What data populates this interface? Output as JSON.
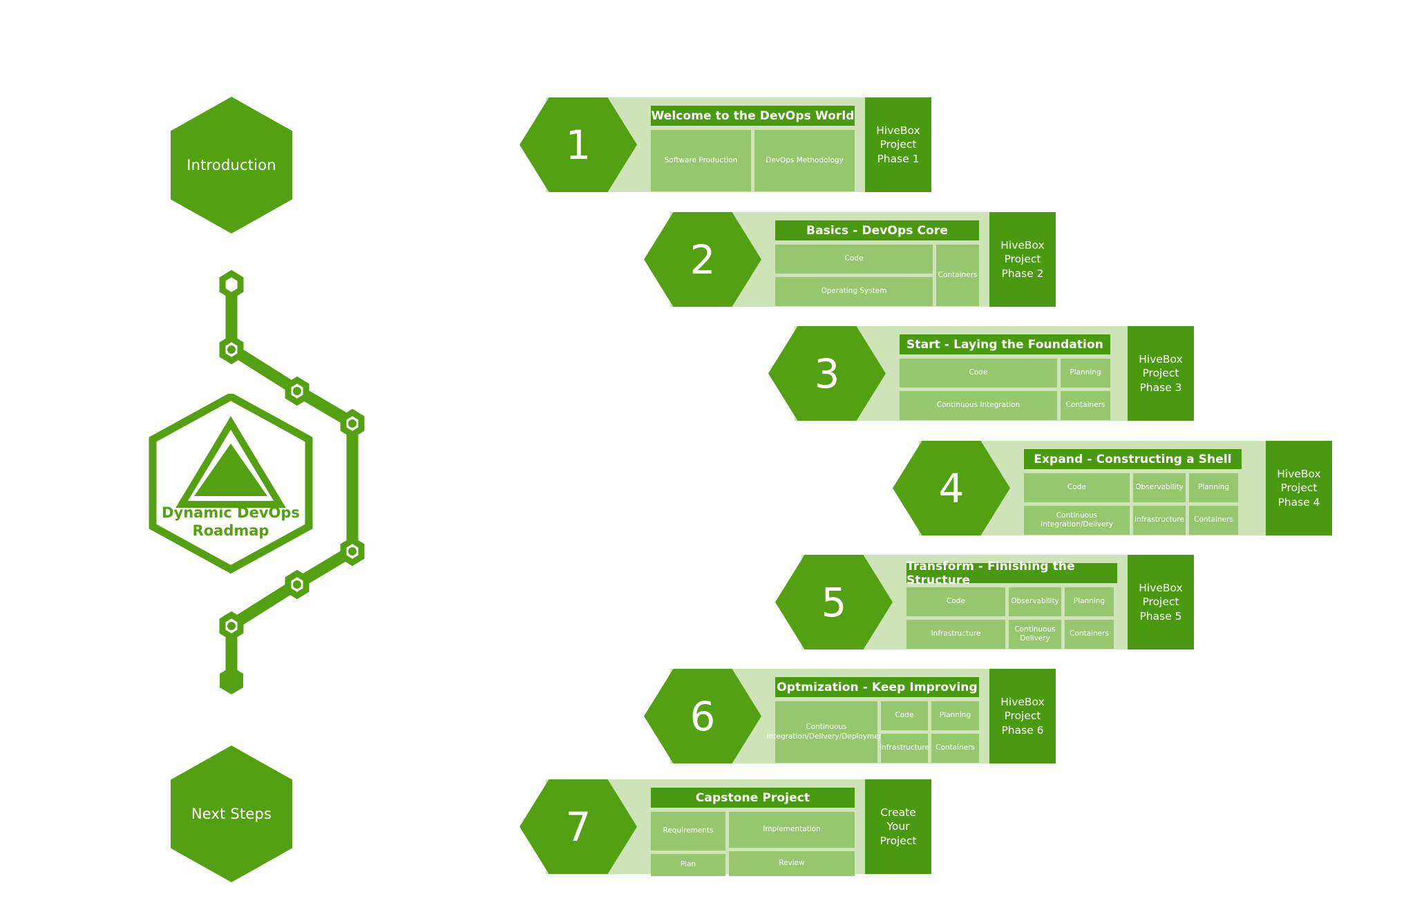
{
  "colors": {
    "dark_green": "#4a9a11",
    "hex_green": "#54a013",
    "band_light": "#cee3b8",
    "cell_green": "#96c76e",
    "white": "#ffffff"
  },
  "left_column": {
    "intro_label": "Introduction",
    "logo_title_line1": "Dynamic DevOps",
    "logo_title_line2": "Roadmap",
    "logo_icon": "triangle-in-hexagon-icon",
    "next_steps_label": "Next Steps",
    "chain_icon": "hexagon-chain-connector"
  },
  "rows": [
    {
      "number": "1",
      "title": "Welcome to the DevOps World",
      "phase_label": "HiveBox\nProject\nPhase 1",
      "phase_lines": [
        "HiveBox",
        "Project",
        "Phase 1"
      ],
      "layout": "two-equal",
      "cells": [
        [
          "Software Production",
          "DevOps Methodology"
        ]
      ]
    },
    {
      "number": "2",
      "title": "Basics - DevOps Core",
      "phase_label": "HiveBox Project Phase 2",
      "phase_lines": [
        "HiveBox",
        "Project",
        "Phase 2"
      ],
      "layout": "stack-plus-side",
      "cells": [
        [
          "Code"
        ],
        [
          "Operating System"
        ]
      ],
      "side_cell": "Containers"
    },
    {
      "number": "3",
      "title": "Start - Laying the Foundation",
      "phase_label": "HiveBox Project Phase 3",
      "phase_lines": [
        "HiveBox",
        "Project",
        "Phase 3"
      ],
      "layout": "two-by-two",
      "cells": [
        [
          "Code",
          "Planning"
        ],
        [
          "Continuous Integration",
          "Containers"
        ]
      ]
    },
    {
      "number": "4",
      "title": "Expand - Constructing a Shell",
      "phase_label": "HiveBox Project Phase 4",
      "phase_lines": [
        "HiveBox",
        "Project",
        "Phase 4"
      ],
      "layout": "three-by-two",
      "cells": [
        [
          "Code",
          "Observability",
          "Planning"
        ],
        [
          "Continuous Integration/Delivery",
          "Infrastructure",
          "Containers"
        ]
      ]
    },
    {
      "number": "5",
      "title": "Transform - Finishing the Structure",
      "phase_label": "HiveBox Project Phase 5",
      "phase_lines": [
        "HiveBox",
        "Project",
        "Phase 5"
      ],
      "layout": "three-by-two",
      "cells": [
        [
          "Code",
          "Observability",
          "Planning"
        ],
        [
          "Infrastructure",
          "Continuous Delivery",
          "Containers"
        ]
      ]
    },
    {
      "number": "6",
      "title": "Optmization - Keep Improving",
      "phase_label": "HiveBox Project Phase 6",
      "phase_lines": [
        "HiveBox",
        "Project",
        "Phase 6"
      ],
      "layout": "big-left-plus-grid",
      "big_cell": "Continuous Integration/Delivery/Deployment",
      "cells": [
        [
          "Code",
          "Planning"
        ],
        [
          "Infrastructure",
          "Containers"
        ]
      ]
    },
    {
      "number": "7",
      "title": "Capstone Project",
      "phase_label": "Create Your Project",
      "phase_lines": [
        "Create",
        "Your",
        "Project"
      ],
      "layout": "two-by-two-uneven",
      "cells": [
        [
          "Requirements",
          "Implementation"
        ],
        [
          "Plan",
          "Review"
        ]
      ]
    }
  ]
}
